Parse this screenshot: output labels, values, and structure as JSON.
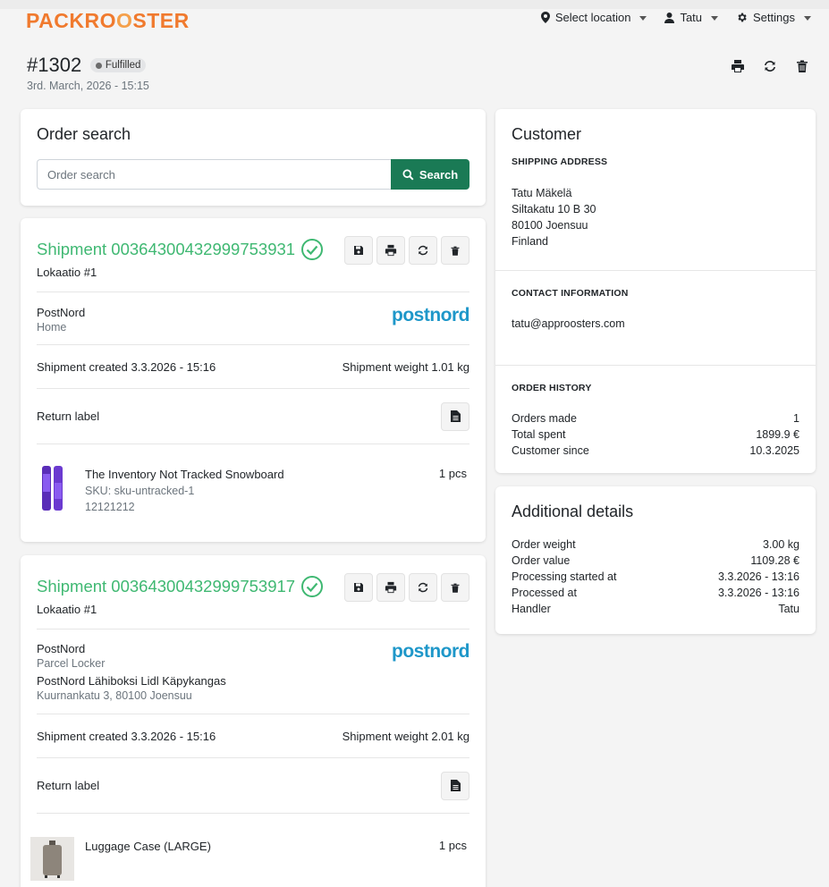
{
  "brand": {
    "logo_a": "PACKR",
    "logo_o1": "O",
    "logo_o2": "O",
    "logo_b": "STER",
    "accent": "#f07a2e"
  },
  "nav": {
    "location": "Select location",
    "user": "Tatu",
    "settings": "Settings"
  },
  "order": {
    "number": "#1302",
    "status": "Fulfilled",
    "date": "3rd. March, 2026 - 15:15"
  },
  "search": {
    "title": "Order search",
    "placeholder": "Order search",
    "button": "Search"
  },
  "shipments": [
    {
      "title": "Shipment 00364300432999753931",
      "location": "Lokaatio #1",
      "carrier": "PostNord",
      "service": "Home",
      "carrier_logo": "postnord",
      "created": "Shipment created 3.3.2026 - 15:16",
      "weight": "Shipment weight 1.01 kg",
      "return_label": "Return label",
      "product": {
        "name": "The Inventory Not Tracked Snowboard",
        "sku": "SKU: sku-untracked-1",
        "barcode": "12121212",
        "qty": "1 pcs"
      }
    },
    {
      "title": "Shipment 00364300432999753917",
      "location": "Lokaatio #1",
      "carrier": "PostNord",
      "service": "Parcel Locker",
      "pickup_name": "PostNord Lähiboksi Lidl Käpykangas",
      "pickup_address": "Kuurnankatu 3, 80100 Joensuu",
      "carrier_logo": "postnord",
      "created": "Shipment created 3.3.2026 - 15:16",
      "weight": "Shipment weight 2.01 kg",
      "return_label": "Return label",
      "product": {
        "name": "Luggage Case (LARGE)",
        "qty": "1 pcs"
      }
    }
  ],
  "customer": {
    "title": "Customer",
    "shipping_label": "SHIPPING ADDRESS",
    "address": [
      "Tatu Mäkelä",
      "Siltakatu 10 B 30",
      "80100 Joensuu",
      "Finland"
    ],
    "contact_label": "CONTACT INFORMATION",
    "email": "tatu@approosters.com",
    "history_label": "ORDER HISTORY",
    "history": [
      {
        "k": "Orders made",
        "v": "1"
      },
      {
        "k": "Total spent",
        "v": "1899.9 €"
      },
      {
        "k": "Customer since",
        "v": "10.3.2025"
      }
    ]
  },
  "additional": {
    "title": "Additional details",
    "rows": [
      {
        "k": "Order weight",
        "v": "3.00 kg"
      },
      {
        "k": "Order value",
        "v": "1109.28 €"
      },
      {
        "k": "Processing started at",
        "v": "3.3.2026 - 13:16"
      },
      {
        "k": "Processed at",
        "v": "3.3.2026 - 13:16"
      },
      {
        "k": "Handler",
        "v": "Tatu"
      }
    ]
  },
  "colors": {
    "primary_button": "#1a7a55",
    "shipment_green": "#3fb872",
    "postnord_blue": "#1e97c9"
  }
}
